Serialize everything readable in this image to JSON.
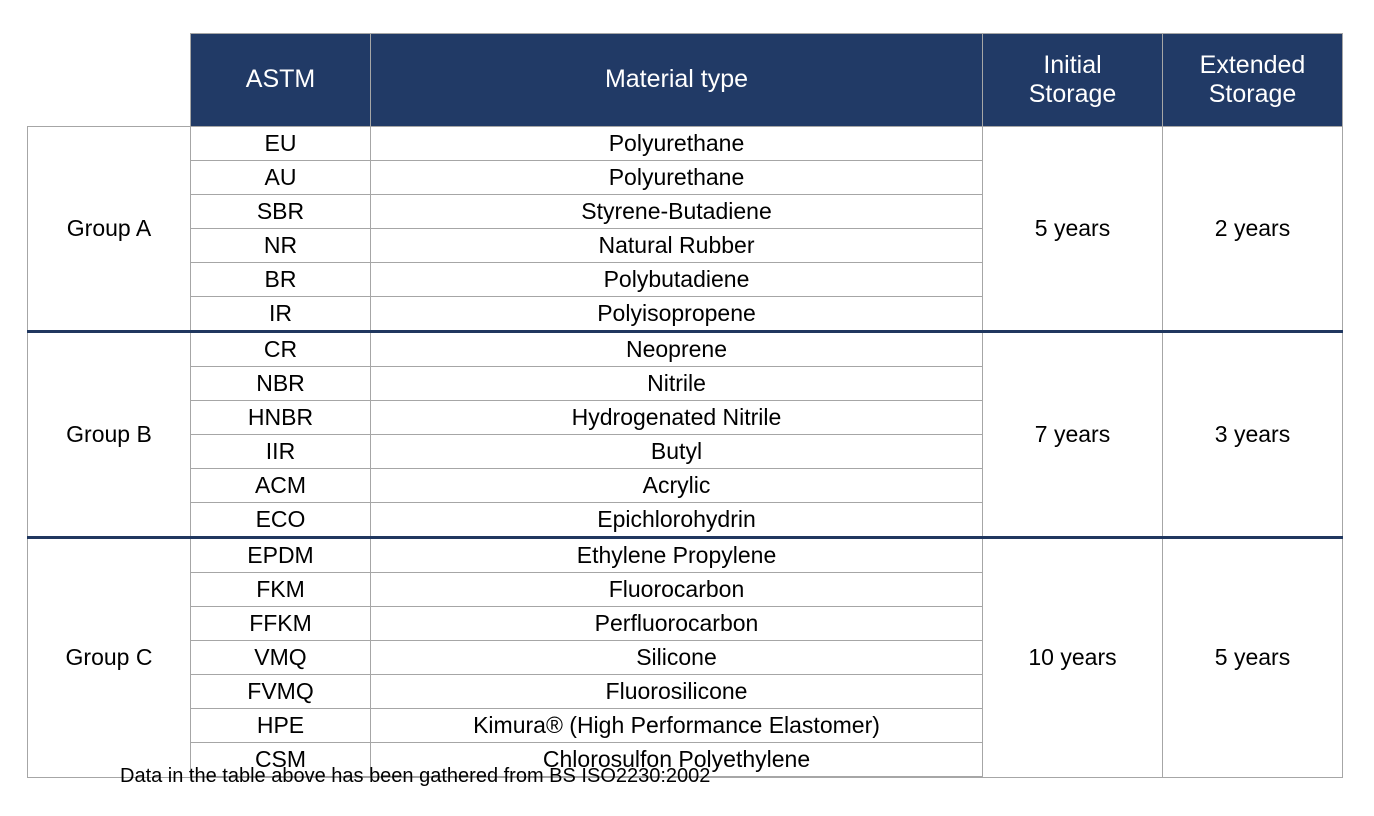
{
  "table": {
    "columns": [
      {
        "key": "group",
        "label": ""
      },
      {
        "key": "astm",
        "label": "ASTM"
      },
      {
        "key": "material",
        "label": "Material type"
      },
      {
        "key": "initial",
        "label": "Initial\nStorage"
      },
      {
        "key": "extended",
        "label": "Extended\nStorage"
      }
    ],
    "header": {
      "blank": "",
      "astm": "ASTM",
      "material": "Material type",
      "initial_line1": "Initial",
      "initial_line2": "Storage",
      "extended_line1": "Extended",
      "extended_line2": "Storage"
    },
    "groups": [
      {
        "name": "Group A",
        "initial_storage": "5 years",
        "extended_storage": "2 years",
        "rows": [
          {
            "astm": "EU",
            "material": "Polyurethane"
          },
          {
            "astm": "AU",
            "material": "Polyurethane"
          },
          {
            "astm": "SBR",
            "material": "Styrene-Butadiene"
          },
          {
            "astm": "NR",
            "material": "Natural Rubber"
          },
          {
            "astm": "BR",
            "material": "Polybutadiene"
          },
          {
            "astm": "IR",
            "material": "Polyisopropene"
          }
        ]
      },
      {
        "name": "Group B",
        "initial_storage": "7 years",
        "extended_storage": "3 years",
        "rows": [
          {
            "astm": "CR",
            "material": "Neoprene"
          },
          {
            "astm": "NBR",
            "material": "Nitrile"
          },
          {
            "astm": "HNBR",
            "material": "Hydrogenated Nitrile"
          },
          {
            "astm": "IIR",
            "material": "Butyl"
          },
          {
            "astm": "ACM",
            "material": "Acrylic"
          },
          {
            "astm": "ECO",
            "material": "Epichlorohydrin"
          }
        ]
      },
      {
        "name": "Group C",
        "initial_storage": "10 years",
        "extended_storage": "5 years",
        "rows": [
          {
            "astm": "EPDM",
            "material": "Ethylene Propylene"
          },
          {
            "astm": "FKM",
            "material": "Fluorocarbon"
          },
          {
            "astm": "FFKM",
            "material": "Perfluorocarbon"
          },
          {
            "astm": "VMQ",
            "material": "Silicone"
          },
          {
            "astm": "FVMQ",
            "material": "Fluorosilicone"
          },
          {
            "astm": "HPE",
            "material": "Kimura® (High Performance Elastomer)"
          },
          {
            "astm": "CSM",
            "material": "Chlorosulfon Polyethylene"
          }
        ]
      }
    ]
  },
  "footnote": "Data in the table above has been gathered from BS ISO2230:2002",
  "colors": {
    "header_background": "#213a66",
    "header_text": "#ffffff",
    "grid_line": "#a6a6a6",
    "group_separator": "#20375f",
    "body_background": "#ffffff",
    "body_text": "#000000"
  }
}
